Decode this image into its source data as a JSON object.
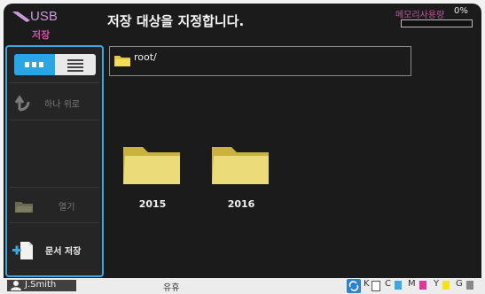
{
  "header": {
    "app_name": "USB",
    "app_sub": "저장",
    "title": "저장 대상을 지정합니다.",
    "memory_label": "메모리사용량",
    "memory_value": "0%",
    "memory_fraction": 0.0
  },
  "sidebar": {
    "view_toggle": {
      "selected": "icon-view"
    },
    "up_label": "하나 위로",
    "open_label": "열기",
    "save_label": "문서 저장"
  },
  "path": "root/",
  "folders": [
    {
      "name": "2015"
    },
    {
      "name": "2016"
    }
  ],
  "status_bar": {
    "user": "J.Smith",
    "status": "유휴",
    "inks": [
      {
        "label": "K",
        "color": "#333333"
      },
      {
        "label": "C",
        "color": "#39a8e4"
      },
      {
        "label": "M",
        "color": "#e0389a"
      },
      {
        "label": "Y",
        "color": "#f4e21a"
      },
      {
        "label": "G",
        "color": "#888888"
      }
    ]
  },
  "colors": {
    "accent": "#39a8e4",
    "brand": "#c05aa1",
    "background": "#1b1b1b"
  }
}
